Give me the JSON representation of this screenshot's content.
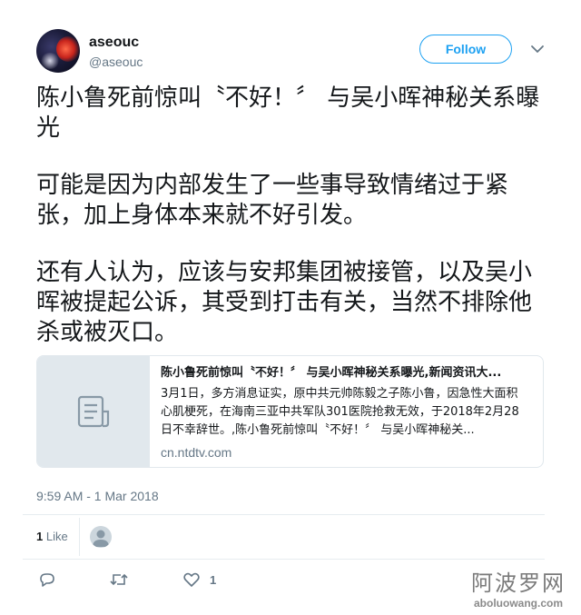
{
  "author": {
    "name": "aseouc",
    "handle": "@aseouc"
  },
  "follow_button": {
    "label": "Follow"
  },
  "tweet": {
    "paragraphs": [
      "陈小鲁死前惊叫〝不好！〞 与吴小晖神秘关系曝光",
      "可能是因为内部发生了一些事导致情绪过于紧张，加上身体本来就不好引发。",
      "还有人认为，应该与安邦集团被接管，以及吴小晖被提起公诉，其受到打击有关，当然不排除他杀或被灭口。"
    ]
  },
  "link_card": {
    "title": "陈小鲁死前惊叫〝不好！〞 与吴小晖神秘关系曝光,新闻资讯大...",
    "description": "3月1日，多方消息证实，原中共元帅陈毅之子陈小鲁，因急性大面积心肌梗死，在海南三亚中共军队301医院抢救无效，于2018年2月28日不幸辞世。,陈小鲁死前惊叫〝不好！〞 与吴小晖神秘关...",
    "domain": "cn.ntdtv.com",
    "thumb_icon": "document-icon"
  },
  "timestamp": "9:59 AM - 1 Mar 2018",
  "stats": {
    "like_count": "1",
    "like_label": "Like"
  },
  "actions": {
    "reply_icon": "reply-icon",
    "retweet_icon": "retweet-icon",
    "like_icon": "heart-icon",
    "like_count": "1"
  },
  "watermark": {
    "text": "阿波罗网",
    "url": "aboluowang.com"
  },
  "colors": {
    "accent": "#1da1f2",
    "text_primary": "#14171a",
    "text_secondary": "#657786",
    "border": "#e1e8ed"
  }
}
